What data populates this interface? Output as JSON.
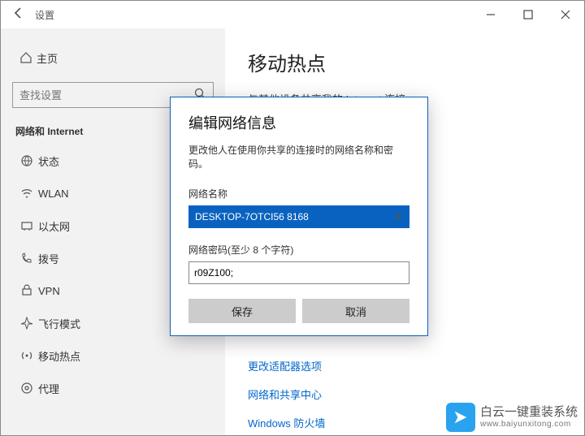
{
  "titlebar": {
    "title": "设置"
  },
  "sidebar": {
    "home": "主页",
    "search_placeholder": "查找设置",
    "group": "网络和 Internet",
    "items": [
      {
        "label": "状态"
      },
      {
        "label": "WLAN"
      },
      {
        "label": "以太网"
      },
      {
        "label": "拨号"
      },
      {
        "label": "VPN"
      },
      {
        "label": "飞行模式"
      },
      {
        "label": "移动热点"
      },
      {
        "label": "代理"
      }
    ]
  },
  "main": {
    "title": "移动热点",
    "subtitle": "与其他设备共享我的 Internet 连接",
    "links": [
      "更改适配器选项",
      "网络和共享中心",
      "Windows 防火墙"
    ]
  },
  "dialog": {
    "title": "编辑网络信息",
    "desc": "更改他人在使用你共享的连接时的网络名称和密码。",
    "name_label": "网络名称",
    "name_value": "DESKTOP-7OTCI56 8168",
    "pwd_label": "网络密码(至少 8 个字符)",
    "pwd_value": "r09Z100;",
    "save": "保存",
    "cancel": "取消"
  },
  "watermark": {
    "line1": "白云一键重装系统",
    "line2": "www.baiyunxitong.com"
  }
}
